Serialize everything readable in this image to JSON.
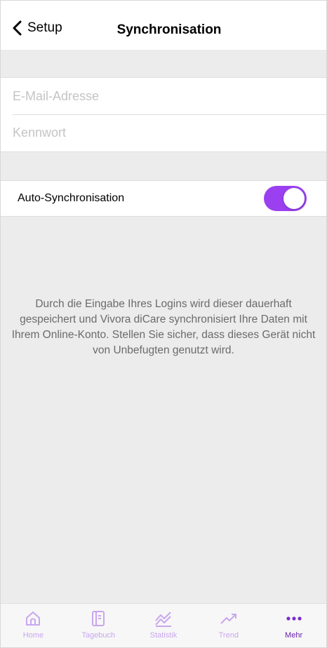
{
  "header": {
    "back_label": "Setup",
    "title": "Synchronisation"
  },
  "login": {
    "email_placeholder": "E-Mail-Adresse",
    "email_value": "",
    "password_placeholder": "Kennwort",
    "password_value": ""
  },
  "sync": {
    "label": "Auto-Synchronisation",
    "enabled": true
  },
  "info": {
    "text": "Durch die Eingabe Ihres Logins wird dieser dauerhaft gespeichert und Vivora diCare synchronisiert Ihre Daten mit Ihrem Online-Konto. Stellen Sie sicher, dass dieses Gerät nicht von Unbefugten genutzt wird."
  },
  "tabbar": {
    "items": [
      {
        "label": "Home",
        "icon": "home-icon",
        "active": false
      },
      {
        "label": "Tagebuch",
        "icon": "diary-icon",
        "active": false
      },
      {
        "label": "Statistik",
        "icon": "statistics-icon",
        "active": false
      },
      {
        "label": "Trend",
        "icon": "trend-icon",
        "active": false
      },
      {
        "label": "Mehr",
        "icon": "more-icon",
        "active": true
      }
    ]
  },
  "colors": {
    "accent": "#9b40f0",
    "tab_inactive": "#c9a7ee",
    "tab_active": "#6a1fb0",
    "background": "#ececec"
  }
}
